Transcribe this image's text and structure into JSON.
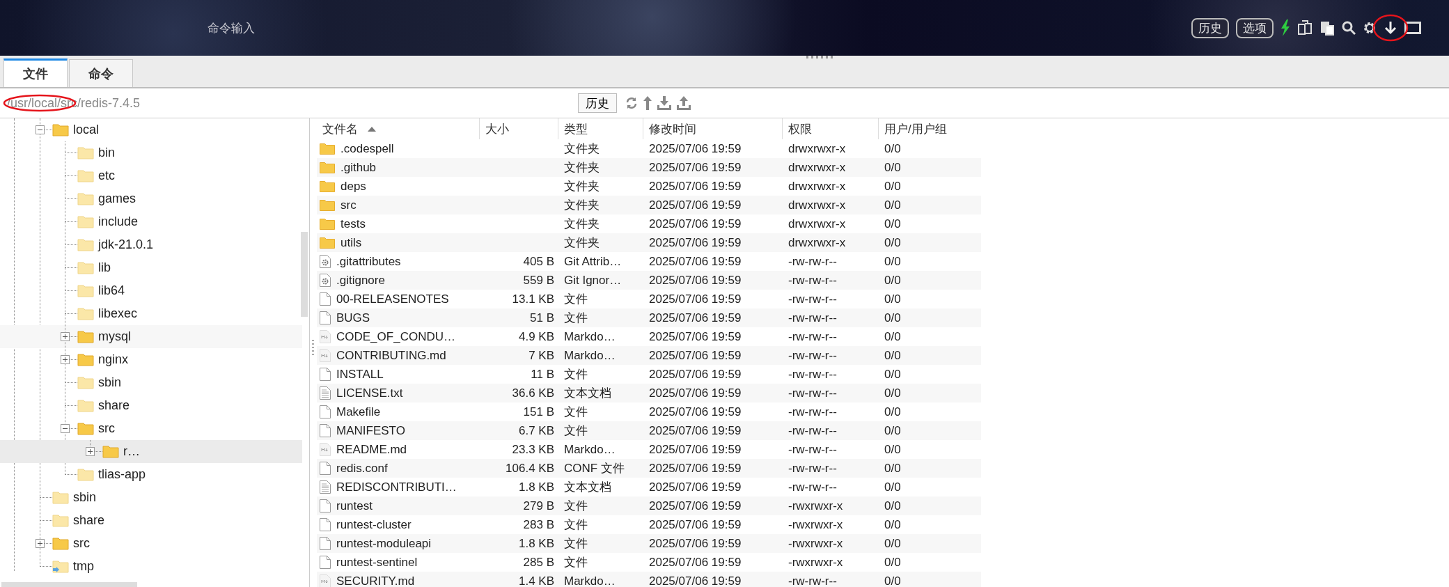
{
  "header": {
    "title": "命令输入",
    "buttons": [
      "历史",
      "选项"
    ]
  },
  "tabs": [
    {
      "label": "文件",
      "selected": true
    },
    {
      "label": "命令",
      "selected": false
    }
  ],
  "path_bar": {
    "path": "/usr/local/src/redis-7.4.5",
    "history_button": "历史"
  },
  "tree": [
    {
      "label": "local",
      "kind": "folder",
      "expanded": true,
      "selected": false,
      "hovered": false,
      "children": [
        {
          "label": "bin",
          "kind": "folder",
          "selected": false,
          "hovered": false
        },
        {
          "label": "etc",
          "kind": "folder",
          "selected": false,
          "hovered": false
        },
        {
          "label": "games",
          "kind": "folder",
          "selected": false,
          "hovered": false
        },
        {
          "label": "include",
          "kind": "folder",
          "selected": false,
          "hovered": false
        },
        {
          "label": "jdk-21.0.1",
          "kind": "folder",
          "selected": false,
          "hovered": false
        },
        {
          "label": "lib",
          "kind": "folder",
          "selected": false,
          "hovered": false
        },
        {
          "label": "lib64",
          "kind": "folder",
          "selected": false,
          "hovered": false
        },
        {
          "label": "libexec",
          "kind": "folder",
          "selected": false,
          "hovered": false
        },
        {
          "label": "mysql",
          "kind": "folder",
          "expanded": false,
          "selected": false,
          "hovered": true
        },
        {
          "label": "nginx",
          "kind": "folder",
          "expanded": false,
          "selected": false,
          "hovered": false
        },
        {
          "label": "sbin",
          "kind": "folder",
          "selected": false,
          "hovered": false
        },
        {
          "label": "share",
          "kind": "folder",
          "selected": false,
          "hovered": false
        },
        {
          "label": "src",
          "kind": "folder",
          "expanded": true,
          "selected": false,
          "hovered": false,
          "children": [
            {
              "label": "r…",
              "kind": "folder",
              "expanded": false,
              "selected": true,
              "hovered": false
            }
          ]
        },
        {
          "label": "tlias-app",
          "kind": "folder",
          "selected": false,
          "hovered": false
        }
      ]
    },
    {
      "label": "sbin",
      "kind": "folder",
      "selected": false,
      "hovered": false
    },
    {
      "label": "share",
      "kind": "folder",
      "selected": false,
      "hovered": false
    },
    {
      "label": "src",
      "kind": "folder",
      "expanded": false,
      "selected": false,
      "hovered": false
    },
    {
      "label": "tmp",
      "kind": "link",
      "selected": false,
      "hovered": false
    }
  ],
  "file_table": {
    "columns": [
      {
        "label": "文件名",
        "sorted": true
      },
      {
        "label": "大小",
        "sorted": false
      },
      {
        "label": "类型",
        "sorted": false
      },
      {
        "label": "修改时间",
        "sorted": false
      },
      {
        "label": "权限",
        "sorted": false
      },
      {
        "label": "用户/用户组",
        "sorted": false
      }
    ],
    "rows": [
      {
        "kind": "folder",
        "name": ".codespell",
        "type": "文件夹",
        "modified": "2025/07/06 19:59",
        "permissions": "drwxrwxr-x",
        "owner": "0/0"
      },
      {
        "kind": "folder",
        "name": ".github",
        "type": "文件夹",
        "modified": "2025/07/06 19:59",
        "permissions": "drwxrwxr-x",
        "owner": "0/0"
      },
      {
        "kind": "folder",
        "name": "deps",
        "type": "文件夹",
        "modified": "2025/07/06 19:59",
        "permissions": "drwxrwxr-x",
        "owner": "0/0"
      },
      {
        "kind": "folder",
        "name": "src",
        "type": "文件夹",
        "modified": "2025/07/06 19:59",
        "permissions": "drwxrwxr-x",
        "owner": "0/0"
      },
      {
        "kind": "folder",
        "name": "tests",
        "type": "文件夹",
        "modified": "2025/07/06 19:59",
        "permissions": "drwxrwxr-x",
        "owner": "0/0"
      },
      {
        "kind": "folder",
        "name": "utils",
        "type": "文件夹",
        "modified": "2025/07/06 19:59",
        "permissions": "drwxrwxr-x",
        "owner": "0/0"
      },
      {
        "kind": "config",
        "name": ".gitattributes",
        "size": "405 B",
        "type": "Git Attrib…",
        "modified": "2025/07/06 19:59",
        "permissions": "-rw-rw-r--",
        "owner": "0/0"
      },
      {
        "kind": "config",
        "name": ".gitignore",
        "size": "559 B",
        "type": "Git Ignor…",
        "modified": "2025/07/06 19:59",
        "permissions": "-rw-rw-r--",
        "owner": "0/0"
      },
      {
        "kind": "file",
        "name": "00-RELEASENOTES",
        "size": "13.1 KB",
        "type": "文件",
        "modified": "2025/07/06 19:59",
        "permissions": "-rw-rw-r--",
        "owner": "0/0"
      },
      {
        "kind": "file",
        "name": "BUGS",
        "size": "51 B",
        "type": "文件",
        "modified": "2025/07/06 19:59",
        "permissions": "-rw-rw-r--",
        "owner": "0/0"
      },
      {
        "kind": "markdown",
        "name": "CODE_OF_CONDU…",
        "size": "4.9 KB",
        "type": "Markdo…",
        "modified": "2025/07/06 19:59",
        "permissions": "-rw-rw-r--",
        "owner": "0/0"
      },
      {
        "kind": "markdown",
        "name": "CONTRIBUTING.md",
        "size": "7 KB",
        "type": "Markdo…",
        "modified": "2025/07/06 19:59",
        "permissions": "-rw-rw-r--",
        "owner": "0/0"
      },
      {
        "kind": "file",
        "name": "INSTALL",
        "size": "11 B",
        "type": "文件",
        "modified": "2025/07/06 19:59",
        "permissions": "-rw-rw-r--",
        "owner": "0/0"
      },
      {
        "kind": "text",
        "name": "LICENSE.txt",
        "size": "36.6 KB",
        "type": "文本文档",
        "modified": "2025/07/06 19:59",
        "permissions": "-rw-rw-r--",
        "owner": "0/0"
      },
      {
        "kind": "file",
        "name": "Makefile",
        "size": "151 B",
        "type": "文件",
        "modified": "2025/07/06 19:59",
        "permissions": "-rw-rw-r--",
        "owner": "0/0"
      },
      {
        "kind": "file",
        "name": "MANIFESTO",
        "size": "6.7 KB",
        "type": "文件",
        "modified": "2025/07/06 19:59",
        "permissions": "-rw-rw-r--",
        "owner": "0/0"
      },
      {
        "kind": "markdown",
        "name": "README.md",
        "size": "23.3 KB",
        "type": "Markdo…",
        "modified": "2025/07/06 19:59",
        "permissions": "-rw-rw-r--",
        "owner": "0/0"
      },
      {
        "kind": "file",
        "name": "redis.conf",
        "size": "106.4 KB",
        "type": "CONF 文件",
        "modified": "2025/07/06 19:59",
        "permissions": "-rw-rw-r--",
        "owner": "0/0"
      },
      {
        "kind": "text",
        "name": "REDISCONTRIBUTI…",
        "size": "1.8 KB",
        "type": "文本文档",
        "modified": "2025/07/06 19:59",
        "permissions": "-rw-rw-r--",
        "owner": "0/0"
      },
      {
        "kind": "file",
        "name": "runtest",
        "size": "279 B",
        "type": "文件",
        "modified": "2025/07/06 19:59",
        "permissions": "-rwxrwxr-x",
        "owner": "0/0"
      },
      {
        "kind": "file",
        "name": "runtest-cluster",
        "size": "283 B",
        "type": "文件",
        "modified": "2025/07/06 19:59",
        "permissions": "-rwxrwxr-x",
        "owner": "0/0"
      },
      {
        "kind": "file",
        "name": "runtest-moduleapi",
        "size": "1.8 KB",
        "type": "文件",
        "modified": "2025/07/06 19:59",
        "permissions": "-rwxrwxr-x",
        "owner": "0/0"
      },
      {
        "kind": "file",
        "name": "runtest-sentinel",
        "size": "285 B",
        "type": "文件",
        "modified": "2025/07/06 19:59",
        "permissions": "-rwxrwxr-x",
        "owner": "0/0"
      },
      {
        "kind": "markdown",
        "name": "SECURITY.md",
        "size": "1.4 KB",
        "type": "Markdo…",
        "modified": "2025/07/06 19:59",
        "permissions": "-rw-rw-r--",
        "owner": "0/0"
      }
    ]
  }
}
